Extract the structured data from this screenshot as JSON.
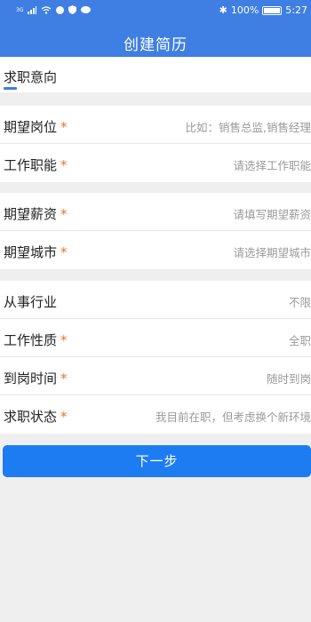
{
  "status": {
    "network": "3G",
    "battery": "100%",
    "time": "5:27",
    "icons": [
      "signal-icon",
      "wifi-icon",
      "app-icon",
      "shield-icon",
      "chat-icon",
      "bluetooth-icon",
      "battery-icon"
    ]
  },
  "header": {
    "title": "创建简历"
  },
  "section": {
    "title": "求职意向"
  },
  "groups": [
    [
      {
        "label": "期望岗位",
        "required": "*",
        "value": "比如：销售总监,销售经理"
      },
      {
        "label": "工作职能",
        "required": "*",
        "value": "请选择工作职能"
      }
    ],
    [
      {
        "label": "期望薪资",
        "required": "*",
        "value": "请填写期望薪资"
      },
      {
        "label": "期望城市",
        "required": "*",
        "value": "请选择期望城市"
      }
    ],
    [
      {
        "label": "从事行业",
        "required": "",
        "value": "不限"
      },
      {
        "label": "工作性质",
        "required": "*",
        "value": "全职"
      },
      {
        "label": "到岗时间",
        "required": "*",
        "value": "随时到岗"
      },
      {
        "label": "求职状态",
        "required": "*",
        "value": "我目前在职，但考虑换个新环境"
      }
    ]
  ],
  "button": {
    "label": "下一步"
  },
  "colors": {
    "primary": "#3f7fe3",
    "button": "#1e7cf2",
    "required": "#f07022",
    "background": "#efefef"
  }
}
